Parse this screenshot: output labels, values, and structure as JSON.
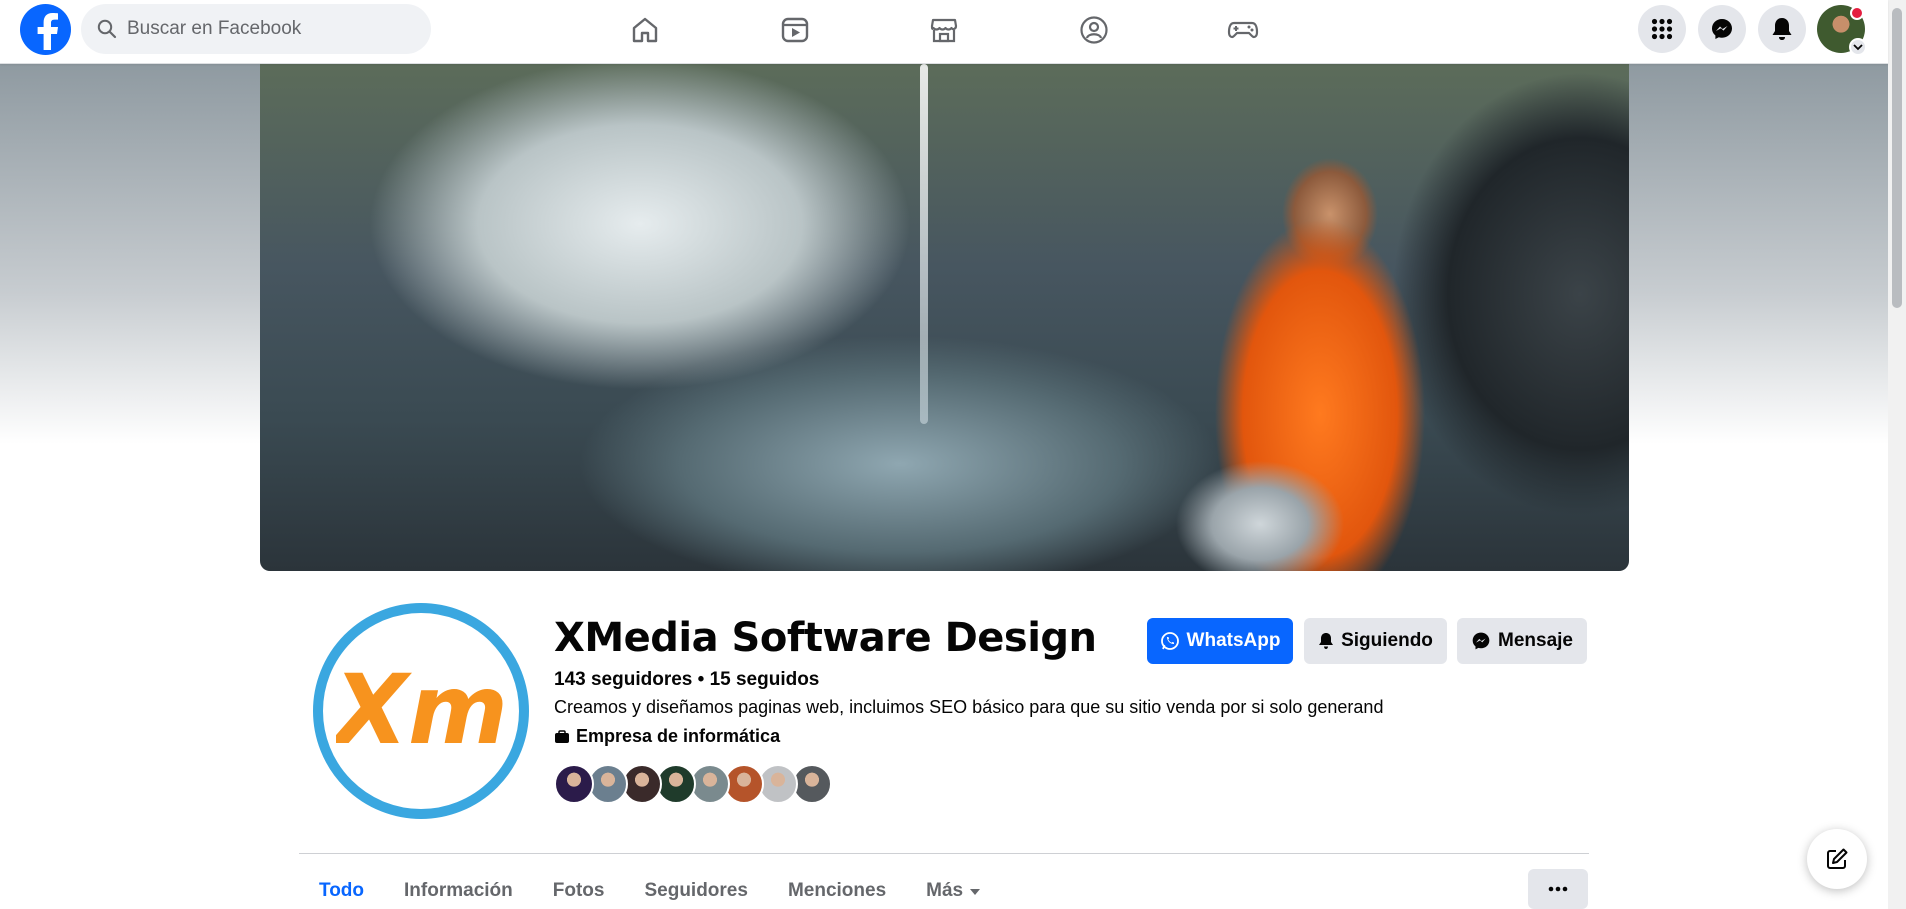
{
  "topbar": {
    "search_placeholder": "Buscar en Facebook",
    "brand_color": "#0866ff",
    "nav_icons": [
      "home-icon",
      "video-icon",
      "marketplace-icon",
      "groups-icon",
      "gaming-icon"
    ],
    "right_icons": [
      "menu-grid-icon",
      "messenger-icon",
      "bell-icon"
    ]
  },
  "profile": {
    "name": "XMedia Software Design",
    "followers": "143 seguidores",
    "separator": " • ",
    "following": "15 seguidos",
    "bio": "Creamos y diseñamos paginas web, incluimos SEO básico para que su sitio venda por si solo generand",
    "category": "Empresa de informática",
    "logo_text": "Xm",
    "logo_colors": {
      "ring": "#3aa7e0",
      "text": "#f7931e"
    }
  },
  "actions": {
    "whatsapp": "WhatsApp",
    "following": "Siguiendo",
    "message": "Mensaje"
  },
  "tabs": [
    {
      "label": "Todo",
      "active": true
    },
    {
      "label": "Información",
      "active": false
    },
    {
      "label": "Fotos",
      "active": false
    },
    {
      "label": "Seguidores",
      "active": false
    },
    {
      "label": "Menciones",
      "active": false
    },
    {
      "label": "Más",
      "active": false
    }
  ],
  "friend_avatar_colors": [
    "#2b1b4a",
    "#6b7f8f",
    "#3a2a2a",
    "#1f3b2b",
    "#7a8a8e",
    "#b5542a",
    "#c0c2c5",
    "#55595d"
  ]
}
